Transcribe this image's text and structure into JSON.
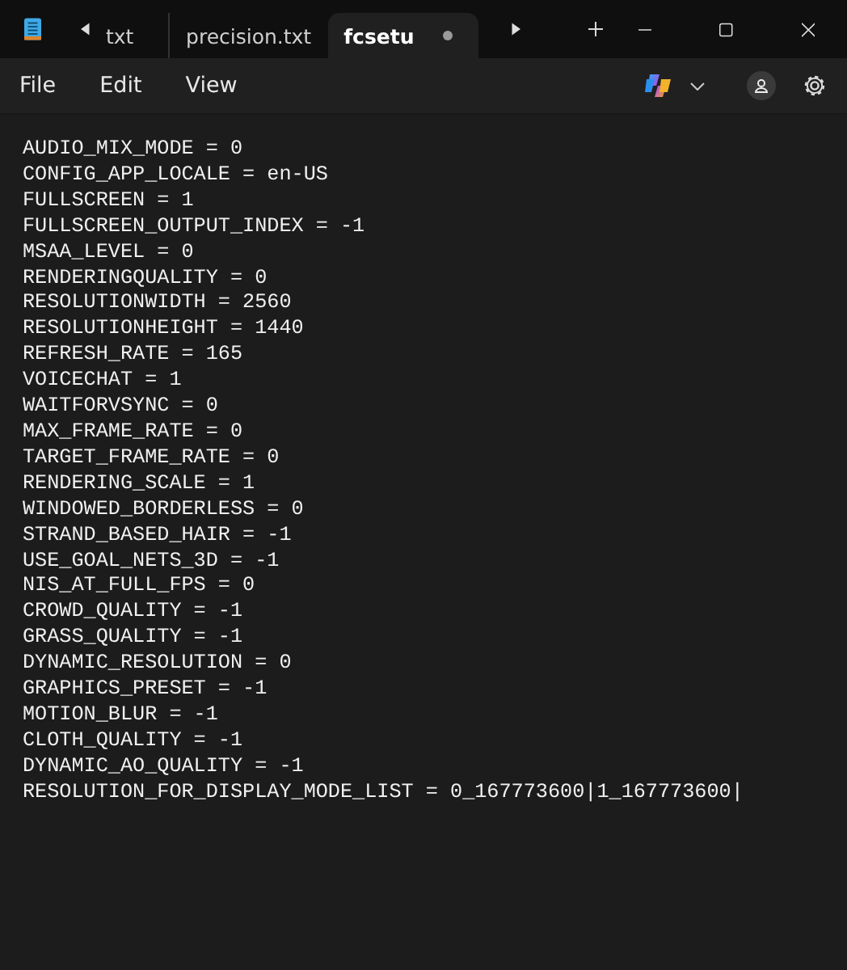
{
  "tabs": [
    {
      "label": "txt",
      "selected": false,
      "modified": false
    },
    {
      "label": "precision.txt",
      "selected": false,
      "modified": false
    },
    {
      "label": "fcsetu",
      "selected": true,
      "modified": true
    }
  ],
  "menu": [
    "File",
    "Edit",
    "View"
  ],
  "editor": {
    "lines": [
      "AUDIO_MIX_MODE = 0",
      "CONFIG_APP_LOCALE = en-US",
      "FULLSCREEN = 1",
      "FULLSCREEN_OUTPUT_INDEX = -1",
      "MSAA_LEVEL = 0",
      "RENDERINGQUALITY = 0",
      "RESOLUTIONWIDTH = 2560",
      "RESOLUTIONHEIGHT = 1440",
      "REFRESH_RATE = 165",
      "VOICECHAT = 1",
      "WAITFORVSYNC = 0",
      "MAX_FRAME_RATE = 0",
      "TARGET_FRAME_RATE = 0",
      "RENDERING_SCALE = 1",
      "WINDOWED_BORDERLESS = 0",
      "STRAND_BASED_HAIR = -1",
      "USE_GOAL_NETS_3D = -1",
      "NIS_AT_FULL_FPS = 0",
      "CROWD_QUALITY = -1",
      "GRASS_QUALITY = -1",
      "DYNAMIC_RESOLUTION = 0",
      "GRAPHICS_PRESET = -1",
      "MOTION_BLUR = -1",
      "CLOTH_QUALITY = -1",
      "DYNAMIC_AO_QUALITY = -1",
      "RESOLUTION_FOR_DISPLAY_MODE_LIST = 0_167773600|1_167773600|"
    ]
  }
}
